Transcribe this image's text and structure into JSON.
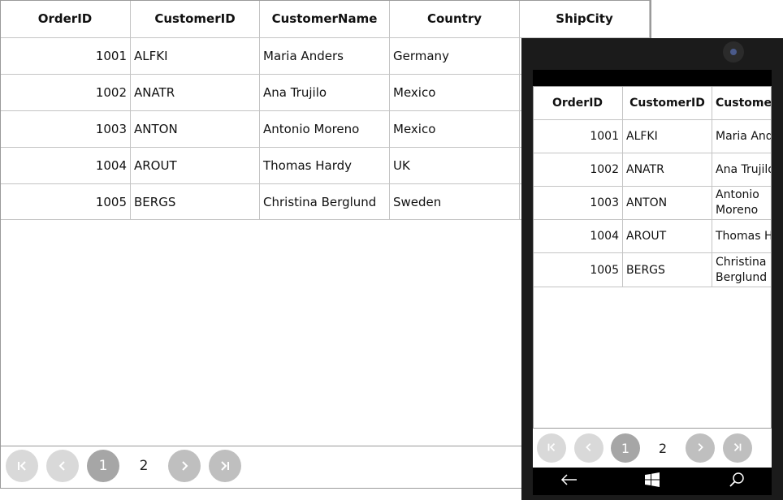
{
  "grid": {
    "columns": [
      "OrderID",
      "CustomerID",
      "CustomerName",
      "Country",
      "ShipCity"
    ],
    "rows": [
      {
        "order_id": "1001",
        "customer_id": "ALFKI",
        "customer_name": "Maria Anders",
        "country": "Germany"
      },
      {
        "order_id": "1002",
        "customer_id": "ANATR",
        "customer_name": "Ana Trujilo",
        "country": "Mexico"
      },
      {
        "order_id": "1003",
        "customer_id": "ANTON",
        "customer_name": "Antonio Moreno",
        "country": "Mexico"
      },
      {
        "order_id": "1004",
        "customer_id": "AROUT",
        "customer_name": "Thomas Hardy",
        "country": "UK"
      },
      {
        "order_id": "1005",
        "customer_id": "BERGS",
        "customer_name": "Christina Berglund",
        "country": "Sweden"
      }
    ]
  },
  "pager": {
    "pages": [
      "1",
      "2"
    ],
    "current_page": "1",
    "icons": [
      "first-page-icon",
      "previous-page-icon",
      "next-page-icon",
      "last-page-icon"
    ]
  },
  "phone": {
    "nav_icons": [
      "back-arrow-icon",
      "windows-logo-icon",
      "search-icon"
    ]
  },
  "colors": {
    "pager_disabled": "#d9d9d9",
    "pager_enabled": "#bfbfbf",
    "pager_active": "#a6a6a6",
    "phone_frame": "#1b1b1b",
    "grid_line": "#c4c4c4"
  }
}
